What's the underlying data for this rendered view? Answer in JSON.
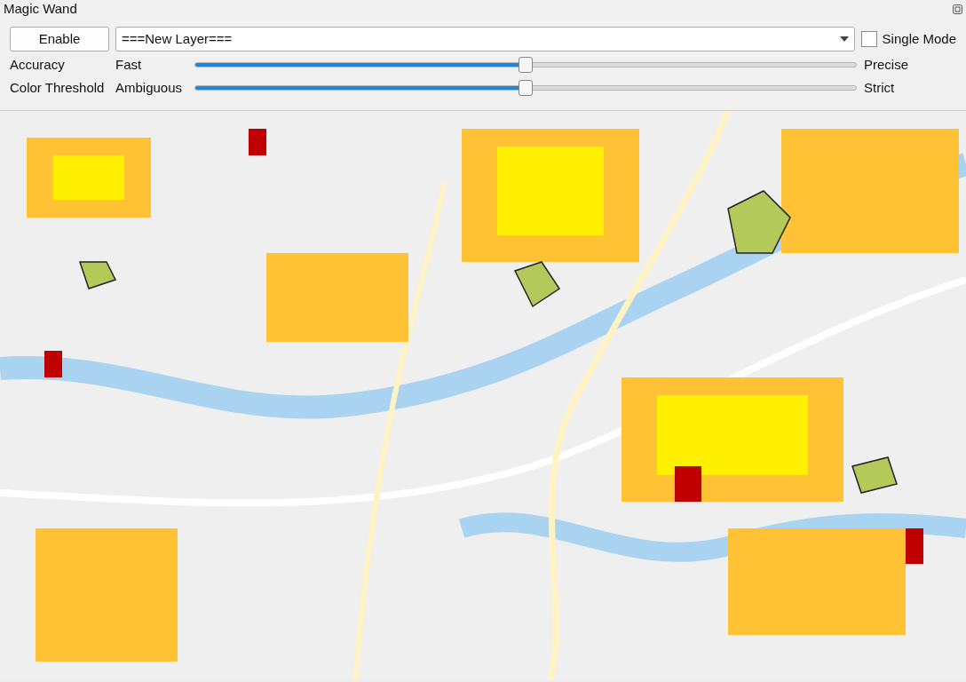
{
  "panel": {
    "title": "Magic Wand"
  },
  "enable_button": {
    "label": "Enable"
  },
  "layer_select": {
    "value": "===New Layer==="
  },
  "single_mode": {
    "label": "Single Mode",
    "checked": false
  },
  "sliders": [
    {
      "label": "Accuracy",
      "min_label": "Fast",
      "max_label": "Precise",
      "level": 0.5
    },
    {
      "label": "Color Threshold",
      "min_label": "Ambiguous",
      "max_label": "Strict",
      "level": 0.5
    }
  ]
}
